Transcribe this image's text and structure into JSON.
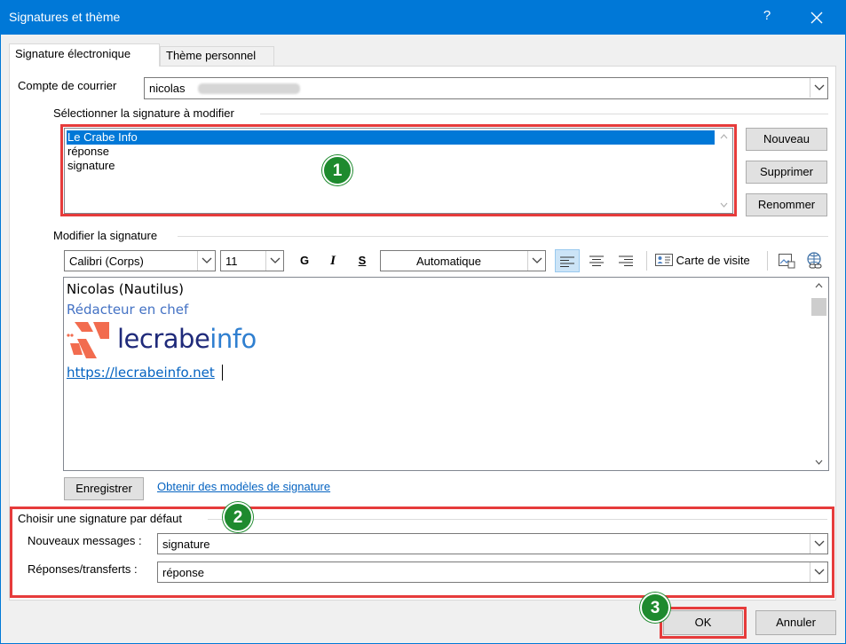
{
  "window": {
    "title": "Signatures et thème",
    "help_label": "?"
  },
  "tabs": [
    {
      "label": "Signature électronique",
      "active": true
    },
    {
      "label": "Thème personnel",
      "active": false
    }
  ],
  "account": {
    "label": "Compte de courrier",
    "value": "nicolas"
  },
  "select_section": {
    "label": "Sélectionner la signature à modifier",
    "signatures": [
      "Le Crabe Info",
      "réponse",
      "signature"
    ],
    "selected_index": 0,
    "buttons": {
      "new": "Nouveau",
      "delete": "Supprimer",
      "rename": "Renommer"
    }
  },
  "edit_section": {
    "label": "Modifier la signature",
    "font": "Calibri (Corps)",
    "size": "11",
    "bold": "G",
    "italic": "I",
    "underline": "S",
    "color": "Automatique",
    "business_card": "Carte de visite",
    "alignment": "left"
  },
  "signature_content": {
    "name": "Nicolas (Nautilus)",
    "role": "Rédacteur en chef",
    "logo_text_1": "lecrabe",
    "logo_text_2": "info",
    "url": "https://lecrabeinfo.net"
  },
  "save_button": "Enregistrer",
  "templates_link": "Obtenir des modèles de signature",
  "default_section": {
    "label": "Choisir une signature par défaut",
    "new_messages_label": "Nouveaux messages :",
    "new_messages_value": "signature",
    "replies_label": "Réponses/transferts :",
    "replies_value": "réponse"
  },
  "footer": {
    "ok": "OK",
    "cancel": "Annuler"
  },
  "annotations": [
    "1",
    "2",
    "3"
  ],
  "colors": {
    "accent": "#0078d7",
    "highlight_red": "#e63b3b",
    "marker_green": "#1e8a2e",
    "role_blue": "#4472c4",
    "logo_orange": "#f26c4f",
    "logo_navy": "#1f2a7a",
    "logo_blue": "#2f7fd0",
    "link": "#0563c1"
  }
}
